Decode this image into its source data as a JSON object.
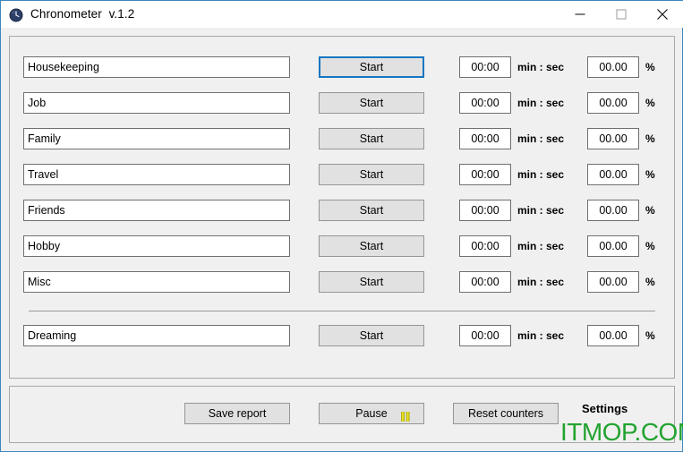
{
  "window": {
    "title": "Chronometer  v.1.2",
    "icon": "clock-icon",
    "accent_color": "#3c87bd",
    "panel_bg": "#f0f0f0",
    "controls": {
      "minimize": "minimize-icon",
      "maximize": "maximize-icon",
      "close": "close-icon"
    }
  },
  "rows": [
    {
      "name": "Housekeeping",
      "start_label": "Start",
      "time": "00:00",
      "time_unit": "min : sec",
      "percent": "00.00",
      "percent_unit": "%",
      "focused": true
    },
    {
      "name": "Job",
      "start_label": "Start",
      "time": "00:00",
      "time_unit": "min : sec",
      "percent": "00.00",
      "percent_unit": "%",
      "focused": false
    },
    {
      "name": "Family",
      "start_label": "Start",
      "time": "00:00",
      "time_unit": "min : sec",
      "percent": "00.00",
      "percent_unit": "%",
      "focused": false
    },
    {
      "name": "Travel",
      "start_label": "Start",
      "time": "00:00",
      "time_unit": "min : sec",
      "percent": "00.00",
      "percent_unit": "%",
      "focused": false
    },
    {
      "name": "Friends",
      "start_label": "Start",
      "time": "00:00",
      "time_unit": "min : sec",
      "percent": "00.00",
      "percent_unit": "%",
      "focused": false
    },
    {
      "name": "Hobby",
      "start_label": "Start",
      "time": "00:00",
      "time_unit": "min : sec",
      "percent": "00.00",
      "percent_unit": "%",
      "focused": false
    },
    {
      "name": "Misc",
      "start_label": "Start",
      "time": "00:00",
      "time_unit": "min : sec",
      "percent": "00.00",
      "percent_unit": "%",
      "focused": false
    },
    {
      "name": "Dreaming",
      "start_label": "Start",
      "time": "00:00",
      "time_unit": "min : sec",
      "percent": "00.00",
      "percent_unit": "%",
      "focused": false
    }
  ],
  "footer": {
    "save_label": "Save report",
    "pause_label": "Pause",
    "pause_icon": "pause-icon",
    "pause_icon_color": "#d7d100",
    "reset_label": "Reset counters",
    "settings_label": "Settings"
  },
  "watermark": {
    "text": "ITMOP.COM",
    "color": "#22a330"
  }
}
